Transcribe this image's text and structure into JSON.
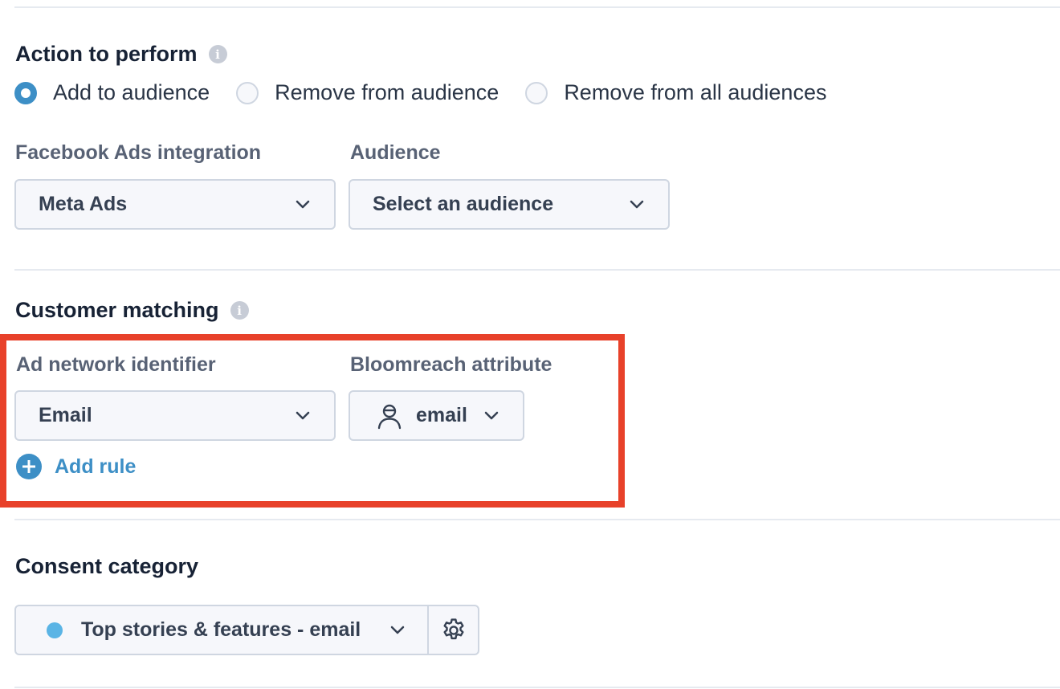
{
  "action_section": {
    "title": "Action to perform",
    "info_icon": "info-icon",
    "options": [
      {
        "label": "Add to audience",
        "checked": true
      },
      {
        "label": "Remove from audience",
        "checked": false
      },
      {
        "label": "Remove from all audiences",
        "checked": false
      }
    ]
  },
  "integration": {
    "label": "Facebook Ads integration",
    "value": "Meta Ads"
  },
  "audience": {
    "label": "Audience",
    "value": "Select an audience"
  },
  "customer_matching": {
    "title": "Customer matching",
    "info_icon": "info-icon",
    "identifier_label": "Ad network identifier",
    "identifier_value": "Email",
    "attribute_label": "Bloomreach attribute",
    "attribute_value": "email",
    "attribute_icon": "customer-icon",
    "add_rule_label": "Add rule"
  },
  "consent": {
    "title": "Consent category",
    "value": "Top stories & features - email",
    "dot_color": "#5ab4e5",
    "settings_icon": "gear-icon"
  },
  "colors": {
    "accent": "#3d8fc6",
    "highlight": "#e8412a"
  }
}
